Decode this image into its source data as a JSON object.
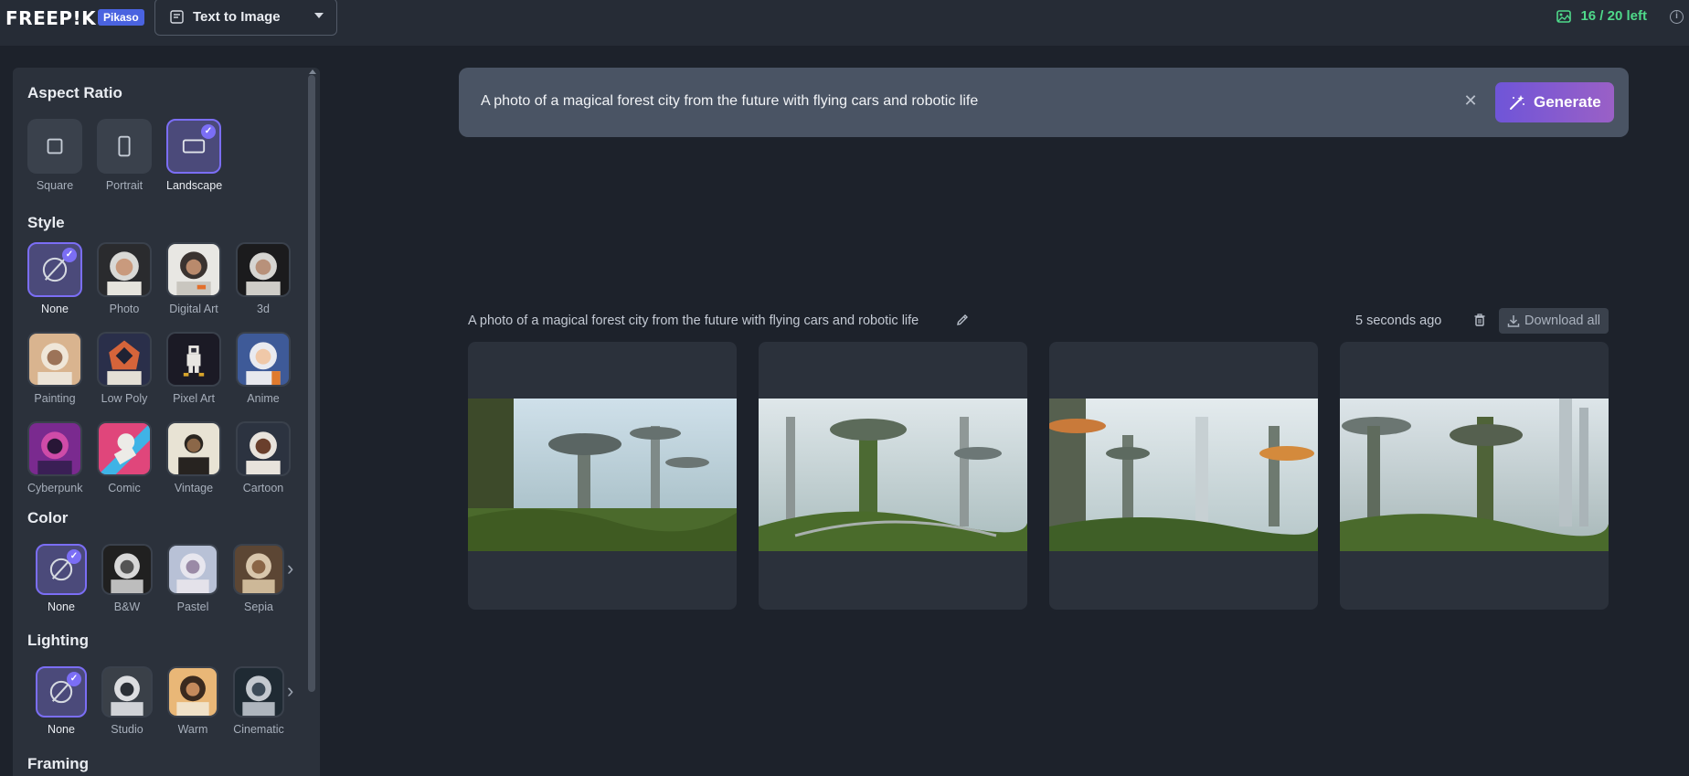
{
  "header": {
    "logo_text": "FREEP!K",
    "badge": "Pikaso",
    "mode_label": "Text to Image",
    "credits": "16 / 20 left",
    "info_symbol": "i"
  },
  "sidebar": {
    "aspect_ratio": {
      "title": "Aspect Ratio",
      "options": [
        {
          "label": "Square"
        },
        {
          "label": "Portrait"
        },
        {
          "label": "Landscape",
          "selected": true
        }
      ]
    },
    "style": {
      "title": "Style",
      "options": [
        {
          "label": "None",
          "selected": true
        },
        {
          "label": "Photo"
        },
        {
          "label": "Digital Art"
        },
        {
          "label": "3d"
        },
        {
          "label": "Painting"
        },
        {
          "label": "Low Poly"
        },
        {
          "label": "Pixel Art"
        },
        {
          "label": "Anime"
        },
        {
          "label": "Cyberpunk"
        },
        {
          "label": "Comic"
        },
        {
          "label": "Vintage"
        },
        {
          "label": "Cartoon"
        }
      ]
    },
    "color": {
      "title": "Color",
      "options": [
        {
          "label": "None",
          "selected": true
        },
        {
          "label": "B&W"
        },
        {
          "label": "Pastel"
        },
        {
          "label": "Sepia"
        }
      ]
    },
    "lighting": {
      "title": "Lighting",
      "options": [
        {
          "label": "None",
          "selected": true
        },
        {
          "label": "Studio"
        },
        {
          "label": "Warm"
        },
        {
          "label": "Cinematic"
        }
      ]
    },
    "framing": {
      "title": "Framing"
    }
  },
  "prompt": {
    "text": "A photo of a magical forest city from the future with flying cars and robotic life",
    "clear_symbol": "✕",
    "generate_label": "Generate"
  },
  "results": {
    "prompt": "A photo of a magical forest city from the future with flying cars and robotic life",
    "timestamp": "5 seconds ago",
    "download_all_label": "Download all",
    "image_count": 4
  },
  "colors": {
    "accent": "#7b6ef5",
    "credits_green": "#4fd98a",
    "background": "#1d222b",
    "panel": "#2b313b"
  },
  "icons": [
    "image-icon",
    "info-icon",
    "wand-icon",
    "close-icon",
    "edit-icon",
    "trash-icon",
    "download-icon",
    "chevron-right-icon",
    "check-icon"
  ]
}
